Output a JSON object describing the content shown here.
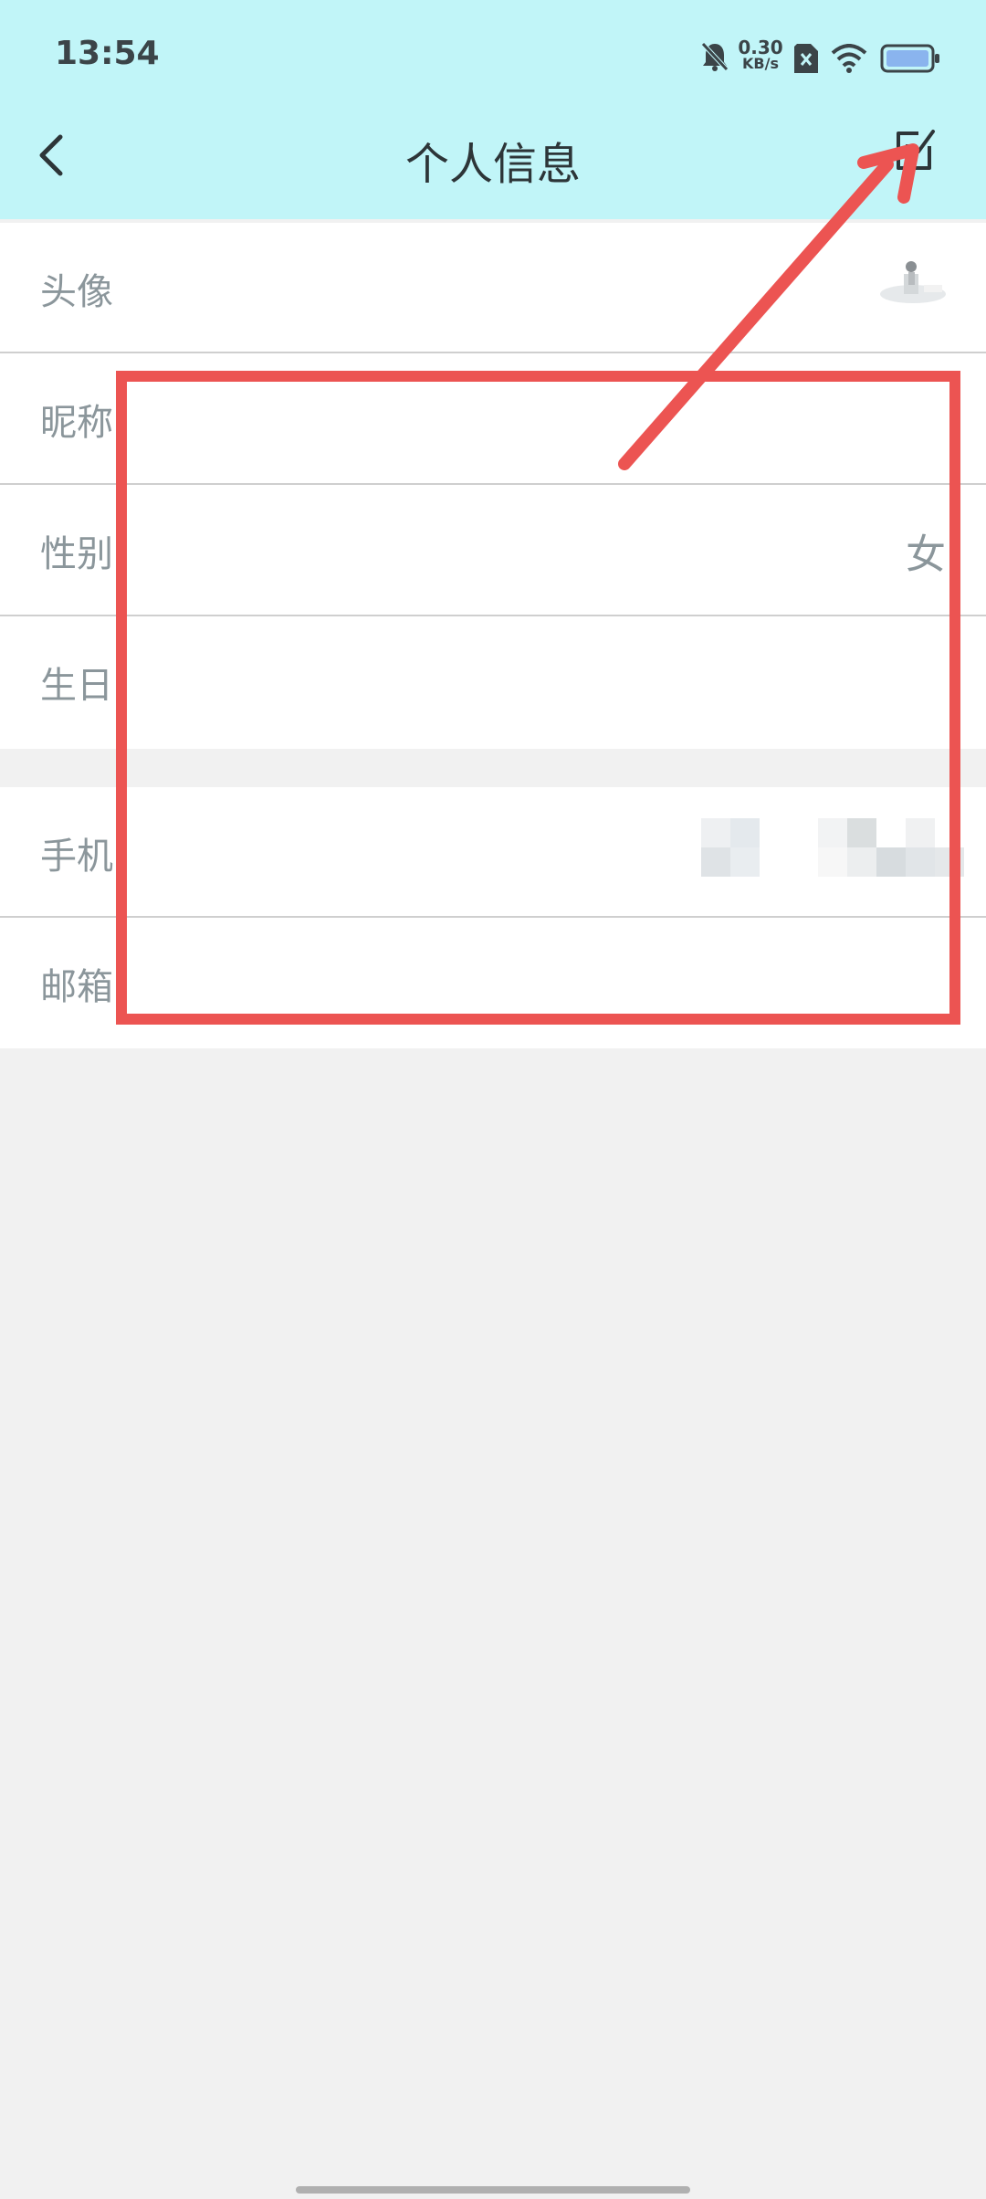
{
  "status": {
    "time": "13:54",
    "net_speed_value": "0.30",
    "net_speed_unit": "KB/s"
  },
  "header": {
    "title": "个人信息",
    "back_icon": "chevron-left-icon",
    "edit_icon": "edit-icon"
  },
  "profile": {
    "avatar_label": "头像",
    "nickname_label": "昵称",
    "gender_label": "性别",
    "gender_value": "女",
    "birthday_label": "生日"
  },
  "contact": {
    "phone_label": "手机",
    "email_label": "邮箱"
  },
  "colors": {
    "header_bg": "#c1f5f8",
    "annotation_red": "#ec5452",
    "label_gray": "#8b969b"
  }
}
